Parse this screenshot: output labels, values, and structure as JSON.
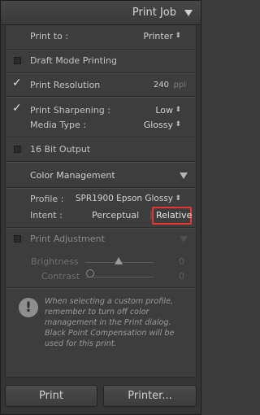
{
  "header": {
    "title": "Print Job"
  },
  "print_to": {
    "label": "Print to :",
    "value": "Printer"
  },
  "draft_mode": {
    "label": "Draft Mode Printing",
    "checked": false
  },
  "print_resolution": {
    "label": "Print Resolution",
    "checked": true,
    "value": "240",
    "unit": "ppi"
  },
  "sharpening": {
    "label": "Print Sharpening :",
    "checked": true,
    "value": "Low",
    "media_label": "Media Type :",
    "media_value": "Glossy"
  },
  "bit16": {
    "label": "16 Bit Output",
    "checked": false
  },
  "color_management": {
    "title": "Color Management",
    "profile_label": "Profile :",
    "profile_value": "SPR1900 Epson Glossy",
    "intent_label": "Intent :",
    "intent_perceptual": "Perceptual",
    "intent_relative": "Relative",
    "selected_intent": "Relative"
  },
  "print_adjustment": {
    "label": "Print Adjustment",
    "checked": false,
    "brightness_label": "Brightness",
    "brightness_value": "0",
    "contrast_label": "Contrast",
    "contrast_value": "0"
  },
  "info": {
    "icon": "!",
    "text": "When selecting a custom profile, remember to turn off color management in the Print dialog. Black Point Compensation will be used for this print."
  },
  "buttons": {
    "print": "Print",
    "printer": "Printer..."
  },
  "colors": {
    "highlight": "#e8352f",
    "background": "#3d3d3d"
  }
}
